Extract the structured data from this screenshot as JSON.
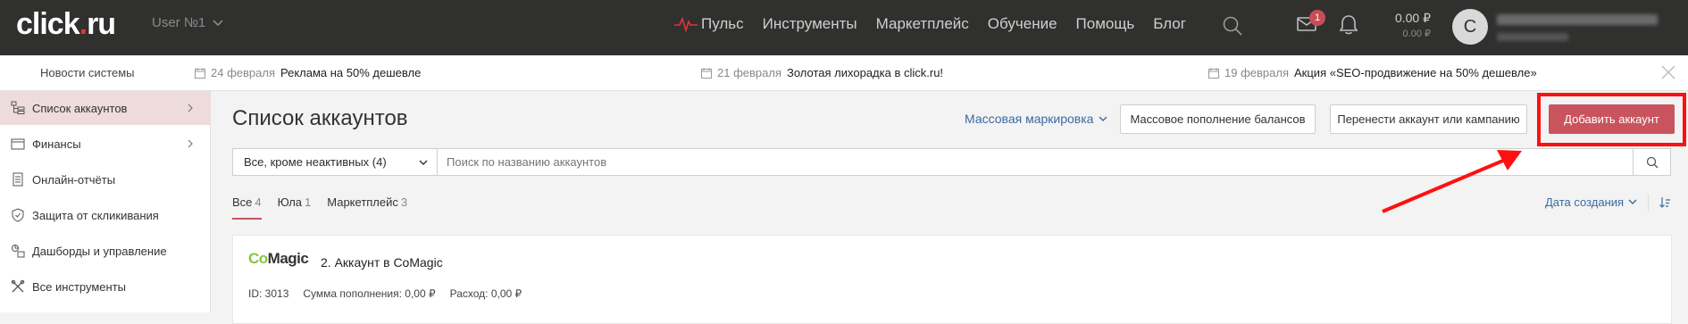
{
  "app": {
    "logo": "click.ru",
    "logo_main": "click",
    "logo_dot": ".",
    "logo_end": "ru",
    "user_selector": "User №1"
  },
  "topnav": {
    "items": [
      "Пульс",
      "Инструменты",
      "Маркетплейс",
      "Обучение",
      "Помощь",
      "Блог"
    ],
    "mail_badge": "1",
    "balance_main": "0.00 ₽",
    "balance_sub": "0.00 ₽",
    "avatar_initial": "C"
  },
  "news": {
    "title": "Новости системы",
    "items": [
      {
        "date": "24 февраля",
        "text": "Реклама на 50% дешевле"
      },
      {
        "date": "21 февраля",
        "text": "Золотая лихорадка в click.ru!"
      },
      {
        "date": "19 февраля",
        "text": "Акция «SEO-продвижение на 50% дешевле»"
      }
    ]
  },
  "sidebar": {
    "items": [
      {
        "label": "Список аккаунтов",
        "icon": "accounts-tree-icon",
        "active": true
      },
      {
        "label": "Финансы",
        "icon": "wallet-icon"
      },
      {
        "label": "Онлайн-отчёты",
        "icon": "report-icon"
      },
      {
        "label": "Защита от скликивания",
        "icon": "shield-icon"
      },
      {
        "label": "Дашборды и управление",
        "icon": "dashboard-icon"
      },
      {
        "label": "Все инструменты",
        "icon": "tools-icon"
      }
    ]
  },
  "main": {
    "title": "Список аккаунтов",
    "mass_marking": "Массовая маркировка",
    "btn_mass_topup": "Массовое пополнение балансов",
    "btn_transfer": "Перенести аккаунт или кампанию",
    "btn_add": "Добавить аккаунт",
    "filter_value": "Все, кроме неактивных (4)",
    "search_placeholder": "Поиск по названию аккаунтов",
    "tabs": [
      {
        "label": "Все",
        "count": "4"
      },
      {
        "label": "Юла",
        "count": "1"
      },
      {
        "label": "Маркетплейс",
        "count": "3"
      }
    ],
    "sort_label": "Дата создания"
  },
  "card": {
    "logo_co": "Co",
    "logo_magic": "Magic",
    "title": "2. Аккаунт в CoMagic",
    "id": "ID: 3013",
    "topup": "Сумма пополнения: 0,00 ₽",
    "spend": "Расход: 0,00 ₽"
  },
  "colors": {
    "topbar": "#30302f",
    "accent": "#c9545e",
    "link": "#3b6aa0",
    "annotation": "#ff1010"
  }
}
